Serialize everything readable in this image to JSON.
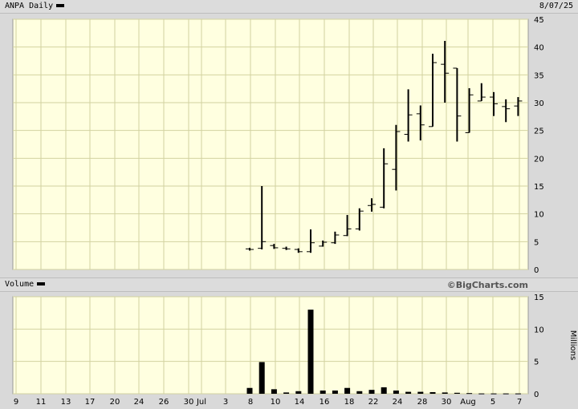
{
  "header": {
    "title": "ANPA Daily",
    "date": "8/07/25"
  },
  "volume_header": {
    "title": "Volume",
    "credit": "©BigCharts.com"
  },
  "colors": {
    "plot_bg": "#ffffe0",
    "grid": "#d2d2a0",
    "bar": "#000000",
    "frame": "#999999"
  },
  "chart_data": [
    {
      "type": "ohlc",
      "ylim": [
        0,
        45
      ],
      "yticks": [
        "0",
        "5",
        "10",
        "15",
        "20",
        "25",
        "30",
        "35",
        "40",
        "45"
      ],
      "grid": true,
      "series": [
        {
          "date": "Jul 8",
          "open": 3.7,
          "high": 3.9,
          "low": 3.4,
          "close": 3.6
        },
        {
          "date": "Jul 9",
          "open": 3.8,
          "high": 15.0,
          "low": 3.6,
          "close": 5.0
        },
        {
          "date": "Jul 10",
          "open": 4.3,
          "high": 4.6,
          "low": 3.7,
          "close": 3.9
        },
        {
          "date": "Jul 11",
          "open": 3.8,
          "high": 4.1,
          "low": 3.5,
          "close": 3.7
        },
        {
          "date": "Jul 14",
          "open": 3.6,
          "high": 3.8,
          "low": 3.0,
          "close": 3.2
        },
        {
          "date": "Jul 15",
          "open": 3.2,
          "high": 7.2,
          "low": 3.0,
          "close": 4.8
        },
        {
          "date": "Jul 16",
          "open": 4.2,
          "high": 5.2,
          "low": 4.1,
          "close": 4.9
        },
        {
          "date": "Jul 17",
          "open": 4.8,
          "high": 6.8,
          "low": 4.6,
          "close": 6.2
        },
        {
          "date": "Jul 18",
          "open": 6.1,
          "high": 9.8,
          "low": 6.0,
          "close": 7.3
        },
        {
          "date": "Jul 21",
          "open": 7.3,
          "high": 11.0,
          "low": 7.0,
          "close": 10.5
        },
        {
          "date": "Jul 22",
          "open": 11.5,
          "high": 12.8,
          "low": 10.4,
          "close": 11.7
        },
        {
          "date": "Jul 23",
          "open": 11.2,
          "high": 21.8,
          "low": 11.0,
          "close": 19.0
        },
        {
          "date": "Jul 24",
          "open": 18.0,
          "high": 26.0,
          "low": 14.2,
          "close": 24.8
        },
        {
          "date": "Jul 25",
          "open": 24.3,
          "high": 32.4,
          "low": 23.0,
          "close": 27.8
        },
        {
          "date": "Jul 28",
          "open": 28.0,
          "high": 29.5,
          "low": 23.2,
          "close": 26.0
        },
        {
          "date": "Jul 29",
          "open": 25.7,
          "high": 38.8,
          "low": 25.7,
          "close": 37.2
        },
        {
          "date": "Jul 30",
          "open": 36.9,
          "high": 41.1,
          "low": 30.0,
          "close": 35.3
        },
        {
          "date": "Jul 31",
          "open": 36.2,
          "high": 36.2,
          "low": 23.0,
          "close": 27.6
        },
        {
          "date": "Aug 1",
          "open": 24.6,
          "high": 32.6,
          "low": 24.6,
          "close": 31.4
        },
        {
          "date": "Aug 4",
          "open": 30.3,
          "high": 33.5,
          "low": 30.3,
          "close": 31.0
        },
        {
          "date": "Aug 5",
          "open": 31.0,
          "high": 31.9,
          "low": 27.6,
          "close": 29.8
        },
        {
          "date": "Aug 6",
          "open": 29.3,
          "high": 30.6,
          "low": 26.5,
          "close": 28.9
        },
        {
          "date": "Aug 7",
          "open": 29.4,
          "high": 31.0,
          "low": 27.6,
          "close": 30.3
        }
      ]
    },
    {
      "type": "bar",
      "ylabel": "Millions",
      "ylim": [
        0,
        15
      ],
      "yticks": [
        "0",
        "5",
        "10",
        "15"
      ],
      "grid": true,
      "categories": [
        "Jul 8",
        "Jul 9",
        "Jul 10",
        "Jul 11",
        "Jul 14",
        "Jul 15",
        "Jul 16",
        "Jul 17",
        "Jul 18",
        "Jul 21",
        "Jul 22",
        "Jul 23",
        "Jul 24",
        "Jul 25",
        "Jul 28",
        "Jul 29",
        "Jul 30",
        "Jul 31",
        "Aug 1",
        "Aug 4",
        "Aug 5",
        "Aug 6",
        "Aug 7"
      ],
      "values": [
        0.9,
        4.9,
        0.7,
        0.2,
        0.4,
        13.0,
        0.5,
        0.5,
        0.9,
        0.4,
        0.6,
        1.0,
        0.5,
        0.3,
        0.3,
        0.25,
        0.2,
        0.15,
        0.1,
        0.05,
        0.05,
        0.05,
        0.05
      ],
      "x_ticks": [
        "9",
        "11",
        "13",
        "17",
        "20",
        "24",
        "26",
        "30",
        "Jul",
        "3",
        "8",
        "10",
        "14",
        "16",
        "18",
        "22",
        "24",
        "28",
        "30",
        "Aug",
        "5",
        "7"
      ]
    }
  ]
}
